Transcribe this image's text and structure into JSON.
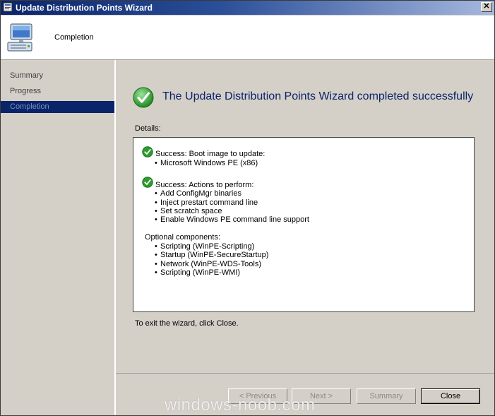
{
  "window": {
    "title": "Update Distribution Points Wizard",
    "close_glyph": "✕"
  },
  "header": {
    "title": "Completion",
    "icon": "computer-icon"
  },
  "sidebar": {
    "items": [
      {
        "label": "Summary",
        "active": false
      },
      {
        "label": "Progress",
        "active": false
      },
      {
        "label": "Completion",
        "active": true
      }
    ]
  },
  "main": {
    "headline": "The Update Distribution Points Wizard completed successfully",
    "details_label": "Details:",
    "sections": [
      {
        "head": "Success: Boot image to update:",
        "items": [
          "Microsoft Windows PE (x86)"
        ]
      },
      {
        "head": "Success: Actions to perform:",
        "items": [
          "Add ConfigMgr binaries",
          "Inject prestart command line",
          "Set scratch space",
          "Enable Windows PE command line support"
        ]
      },
      {
        "head": "Optional components:",
        "items": [
          "Scripting (WinPE-Scripting)",
          "Startup (WinPE-SecureStartup)",
          "Network (WinPE-WDS-Tools)",
          "Scripting (WinPE-WMI)"
        ]
      }
    ],
    "exit_text": "To exit the wizard, click Close."
  },
  "footer": {
    "previous_label": "< Previous",
    "next_label": "Next >",
    "summary_label": "Summary",
    "close_label": "Close"
  },
  "watermark": "windows-noob.com",
  "colors": {
    "title_bar": "#0a246a",
    "headline": "#0a246a",
    "active_nav": "#0a246a",
    "success_green": "#2e9b2e"
  }
}
